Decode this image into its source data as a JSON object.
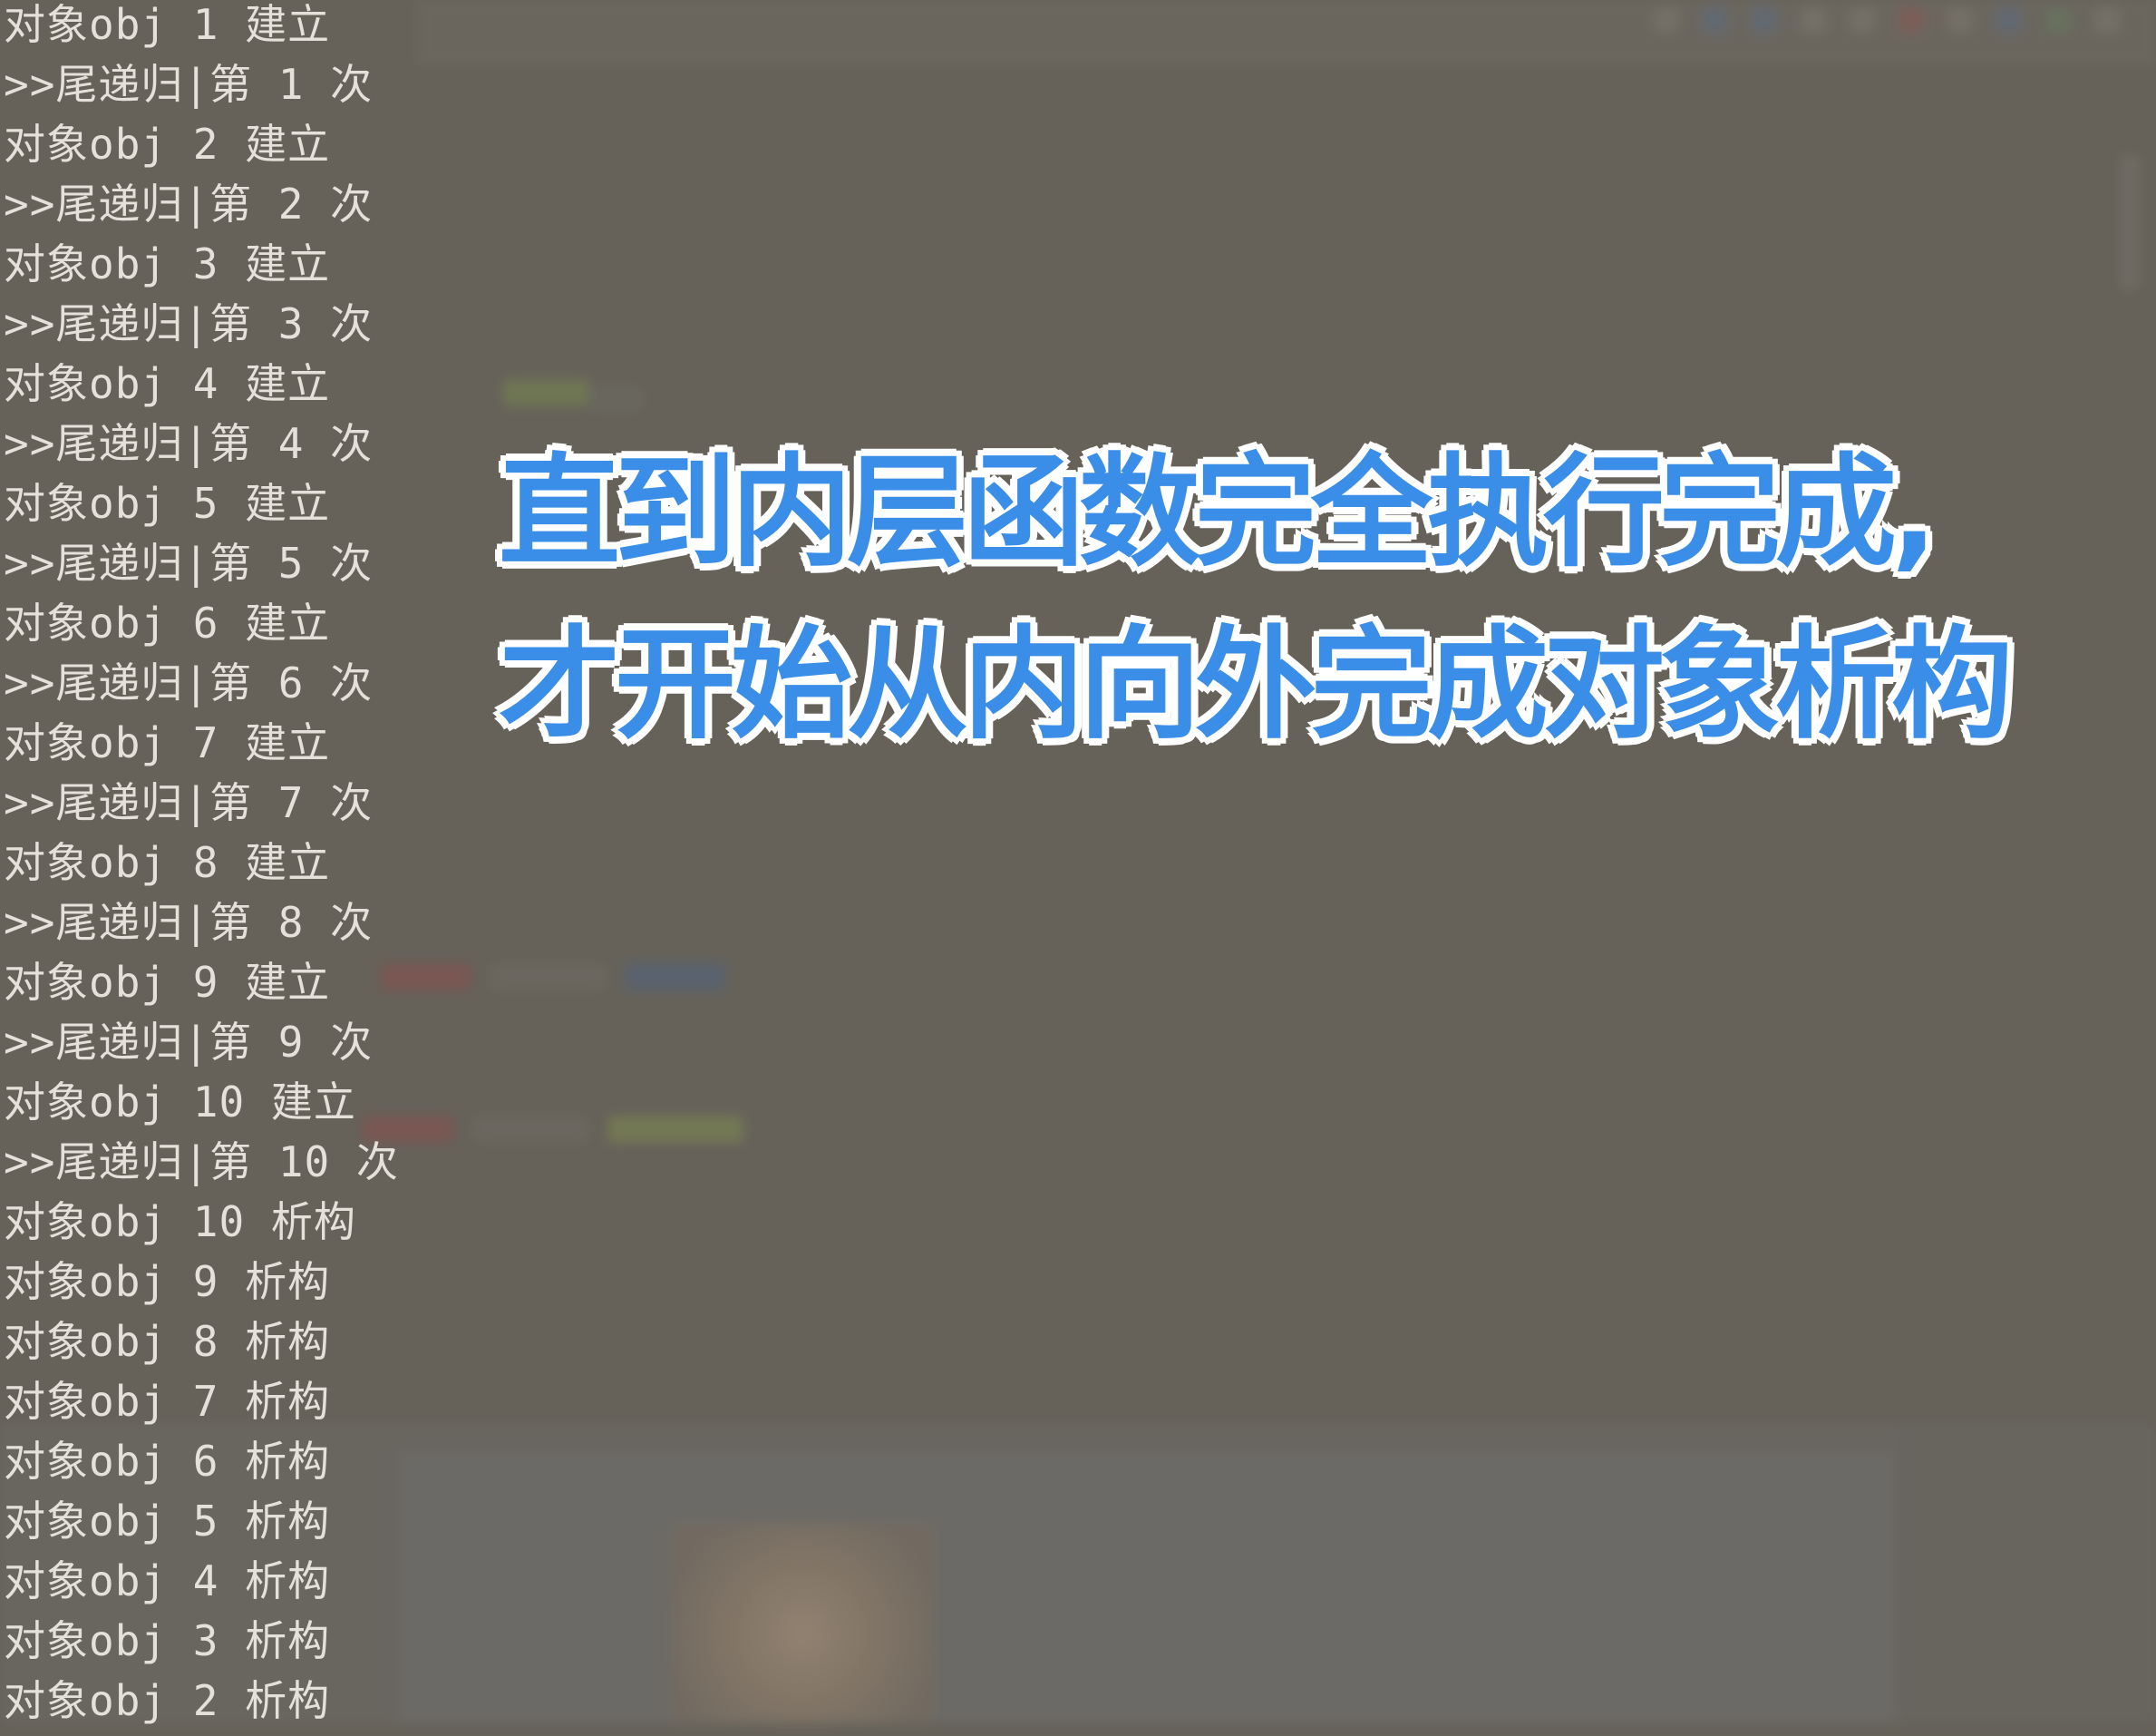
{
  "console": {
    "lines": [
      "对象obj 1 建立",
      ">>尾递归|第 1 次",
      "对象obj 2 建立",
      ">>尾递归|第 2 次",
      "对象obj 3 建立",
      ">>尾递归|第 3 次",
      "对象obj 4 建立",
      ">>尾递归|第 4 次",
      "对象obj 5 建立",
      ">>尾递归|第 5 次",
      "对象obj 6 建立",
      ">>尾递归|第 6 次",
      "对象obj 7 建立",
      ">>尾递归|第 7 次",
      "对象obj 8 建立",
      ">>尾递归|第 8 次",
      "对象obj 9 建立",
      ">>尾递归|第 9 次",
      "对象obj 10 建立",
      ">>尾递归|第 10 次",
      "对象obj 10 析构",
      "对象obj 9 析构",
      "对象obj 8 析构",
      "对象obj 7 析构",
      "对象obj 6 析构",
      "对象obj 5 析构",
      "对象obj 4 析构",
      "对象obj 3 析构",
      "对象obj 2 析构"
    ]
  },
  "caption": {
    "line1": "直到内层函数完全执行完成,",
    "line2": "才开始从内向外完成对象析构"
  },
  "colors": {
    "caption_fill": "#3a8ee8",
    "caption_outline": "#ffffff",
    "console_text": "#e4e1da",
    "background": "#66625a"
  }
}
